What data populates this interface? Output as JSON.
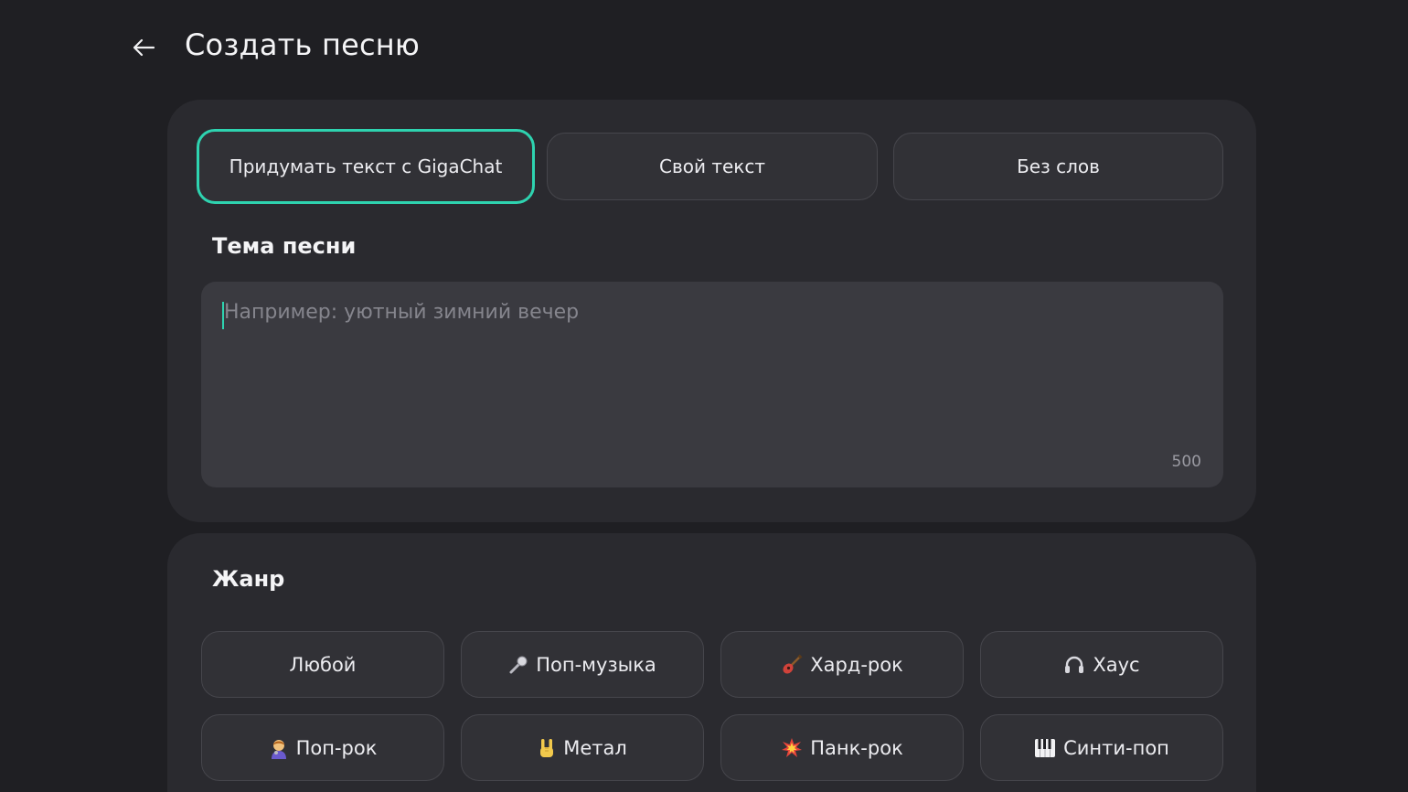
{
  "header": {
    "title": "Создать песню",
    "back_icon": "arrow-left-icon"
  },
  "modes": {
    "active_index": 0,
    "accent_color": "#2ed3b0",
    "tabs": [
      {
        "label": "Придумать текст с GigaChat"
      },
      {
        "label": "Свой текст"
      },
      {
        "label": "Без слов"
      }
    ]
  },
  "theme": {
    "label": "Тема песни",
    "placeholder": "Например: уютный зимний вечер",
    "value": "",
    "counter": "500"
  },
  "genre": {
    "label": "Жанр",
    "items": [
      {
        "label": "Любой",
        "icon": ""
      },
      {
        "label": "Поп-музыка",
        "icon": "microphone-icon"
      },
      {
        "label": "Хард-рок",
        "icon": "guitar-icon"
      },
      {
        "label": "Хаус",
        "icon": "headphones-icon"
      },
      {
        "label": "Поп-рок",
        "icon": "singer-icon"
      },
      {
        "label": "Метал",
        "icon": "rock-hand-icon"
      },
      {
        "label": "Панк-рок",
        "icon": "explosion-icon"
      },
      {
        "label": "Синти-поп",
        "icon": "keyboard-icon"
      }
    ]
  }
}
